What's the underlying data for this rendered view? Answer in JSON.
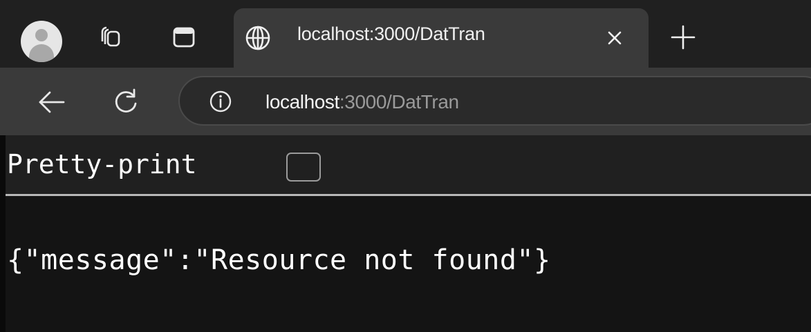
{
  "browser": {
    "tab": {
      "title": "localhost:3000/DatTran",
      "close_symbol": "×"
    },
    "new_tab_symbol": "+",
    "address": {
      "host": "localhost",
      "path": ":3000/DatTran"
    },
    "icons": {
      "profile": "profile-avatar-icon",
      "workspaces": "workspaces-icon",
      "vertical_tabs": "vertical-tabs-icon",
      "site": "globe-icon",
      "back": "back-arrow-icon",
      "reload": "reload-icon",
      "info": "info-icon"
    }
  },
  "page": {
    "pretty_print_label": "Pretty-print",
    "pretty_print_checked": false,
    "json_text": "{\"message\":\"Resource not found\"}"
  }
}
